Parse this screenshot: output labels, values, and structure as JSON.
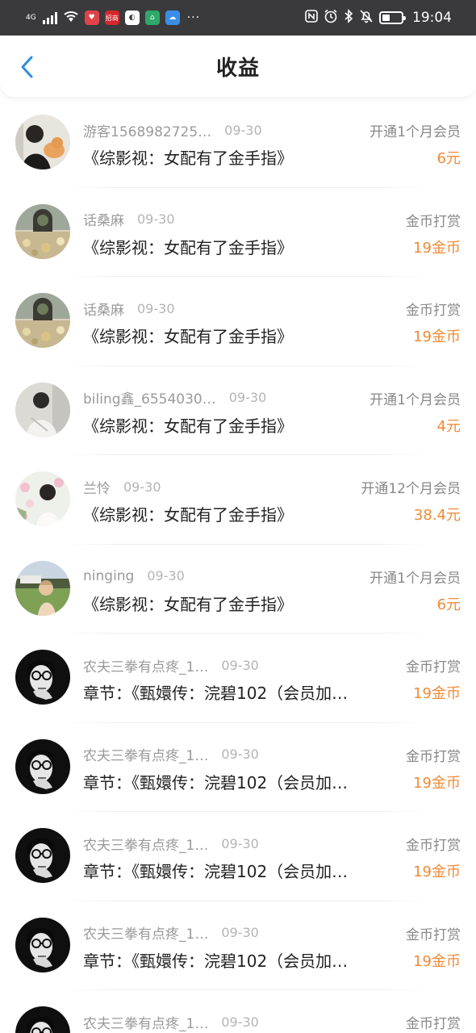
{
  "status_bar": {
    "network": "4G",
    "app_badges": [
      "招商",
      "hi"
    ],
    "time": "19:04",
    "dots": "···"
  },
  "header": {
    "title": "收益"
  },
  "colors": {
    "accent_amount": "#f08a35",
    "back_arrow": "#2f8fe0"
  },
  "records": [
    {
      "user": "游客1568982725…",
      "date": "09-30",
      "type": "开通1个月会员",
      "work": "《综影视：女配有了金手指》",
      "amount": "6元",
      "avatar": "portrait-cat"
    },
    {
      "user": "话桑麻",
      "date": "09-30",
      "type": "金币打赏",
      "work": "《综影视：女配有了金手指》",
      "amount": "19金币",
      "avatar": "garden-arch"
    },
    {
      "user": "话桑麻",
      "date": "09-30",
      "type": "金币打赏",
      "work": "《综影视：女配有了金手指》",
      "amount": "19金币",
      "avatar": "garden-arch"
    },
    {
      "user": "biling鑫_6554030…",
      "date": "09-30",
      "type": "开通1个月会员",
      "work": "《综影视：女配有了金手指》",
      "amount": "4元",
      "avatar": "woman-white"
    },
    {
      "user": "兰怜",
      "date": "09-30",
      "type": "开通12个月会员",
      "work": "《综影视：女配有了金手指》",
      "amount": "38.4元",
      "avatar": "woman-flowers"
    },
    {
      "user": "ninging",
      "date": "09-30",
      "type": "开通1个月会员",
      "work": "《综影视：女配有了金手指》",
      "amount": "6元",
      "avatar": "woman-lawn"
    },
    {
      "user": "农夫三拳有点疼_1…",
      "date": "09-30",
      "type": "金币打赏",
      "work": "章节：《甄嬛传：浣碧102（会员加…",
      "amount": "19金币",
      "avatar": "man-glasses"
    },
    {
      "user": "农夫三拳有点疼_1…",
      "date": "09-30",
      "type": "金币打赏",
      "work": "章节：《甄嬛传：浣碧102（会员加…",
      "amount": "19金币",
      "avatar": "man-glasses"
    },
    {
      "user": "农夫三拳有点疼_1…",
      "date": "09-30",
      "type": "金币打赏",
      "work": "章节：《甄嬛传：浣碧102（会员加…",
      "amount": "19金币",
      "avatar": "man-glasses"
    },
    {
      "user": "农夫三拳有点疼_1…",
      "date": "09-30",
      "type": "金币打赏",
      "work": "章节：《甄嬛传：浣碧102（会员加…",
      "amount": "19金币",
      "avatar": "man-glasses"
    },
    {
      "user": "农夫三拳有点疼_1…",
      "date": "09-30",
      "type": "金币打赏",
      "work": "",
      "amount": "",
      "avatar": "man-glasses"
    }
  ]
}
